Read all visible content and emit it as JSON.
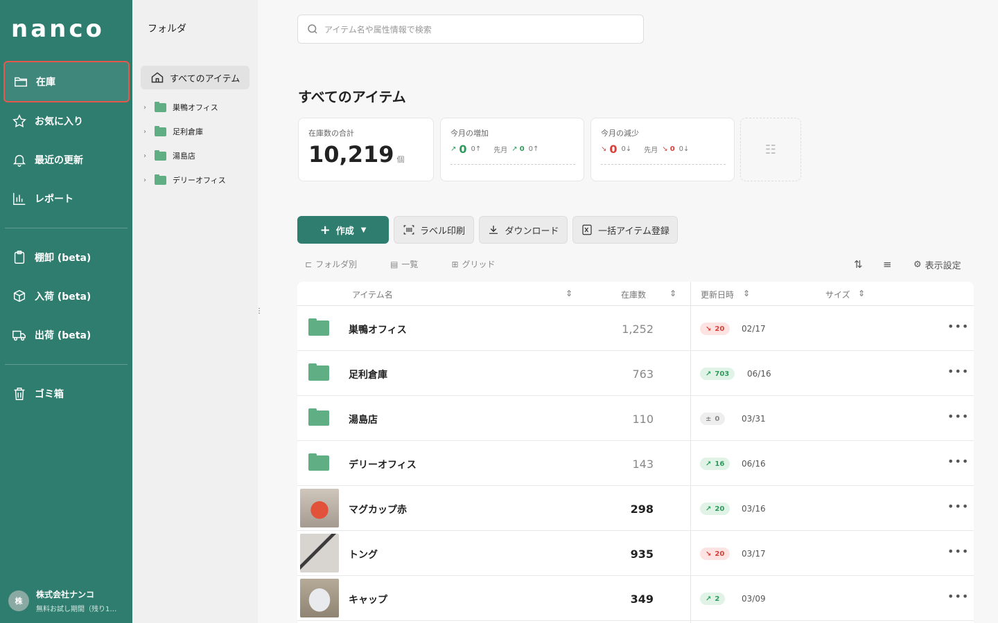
{
  "sidebar": {
    "logo": "nanco",
    "nav": [
      {
        "label": "在庫",
        "icon": "folder-open-icon"
      },
      {
        "label": "お気に入り",
        "icon": "star-icon"
      },
      {
        "label": "最近の更新",
        "icon": "bell-icon"
      },
      {
        "label": "レポート",
        "icon": "bar-chart-icon"
      },
      {
        "label": "棚卸 (beta)",
        "icon": "clipboard-icon"
      },
      {
        "label": "入荷 (beta)",
        "icon": "box-plus-icon"
      },
      {
        "label": "出荷 (beta)",
        "icon": "truck-icon"
      },
      {
        "label": "ゴミ箱",
        "icon": "trash-icon"
      }
    ],
    "account": {
      "avatar": "株",
      "name": "株式会社ナンコ",
      "sub": "無料お試し期間（残り1…"
    }
  },
  "folders": {
    "title": "フォルダ",
    "all_items": "すべてのアイテム",
    "tree": [
      "巣鴨オフィス",
      "足利倉庫",
      "湯島店",
      "デリーオフィス"
    ]
  },
  "search": {
    "placeholder": "アイテム名や属性情報で検索"
  },
  "page_title": "すべてのアイテム",
  "stats": {
    "total_label": "在庫数の合計",
    "total_value": "10,219",
    "total_unit": "個",
    "increase_label": "今月の増加",
    "increase_value": "0",
    "increase_small": "0",
    "increase_prev_label": "先月",
    "increase_prev_value": "0",
    "increase_prev_small": "0",
    "decrease_label": "今月の減少",
    "decrease_value": "0",
    "decrease_small": "0",
    "decrease_prev_label": "先月",
    "decrease_prev_value": "0",
    "decrease_prev_small": "0"
  },
  "toolbar": {
    "create": "作成",
    "label_print": "ラベル印刷",
    "download": "ダウンロード",
    "bulk_register": "一括アイテム登録",
    "view_folder": "フォルダ別",
    "view_list": "一覧",
    "view_grid": "グリッド",
    "display_settings": "表示設定"
  },
  "table": {
    "headers": {
      "name": "アイテム名",
      "qty": "在庫数",
      "updated": "更新日時",
      "size": "サイズ"
    },
    "rows": [
      {
        "name": "巣鴨オフィス",
        "qty": "1,252",
        "delta": "20",
        "date": "02/17",
        "type": "folder",
        "trend": "down"
      },
      {
        "name": "足利倉庫",
        "qty": "763",
        "delta": "703",
        "date": "06/16",
        "type": "folder",
        "trend": "up"
      },
      {
        "name": "湯島店",
        "qty": "110",
        "delta": "0",
        "date": "03/31",
        "type": "folder",
        "trend": "neutral"
      },
      {
        "name": "デリーオフィス",
        "qty": "143",
        "delta": "16",
        "date": "06/16",
        "type": "folder",
        "trend": "up"
      },
      {
        "name": "マグカップ赤",
        "qty": "298",
        "delta": "20",
        "date": "03/16",
        "type": "item",
        "trend": "up"
      },
      {
        "name": "トング",
        "qty": "935",
        "delta": "20",
        "date": "03/17",
        "type": "item",
        "trend": "down"
      },
      {
        "name": "キャップ",
        "qty": "349",
        "delta": "2",
        "date": "03/09",
        "type": "item",
        "trend": "up"
      }
    ]
  },
  "colors": {
    "brand": "#2e7d6f",
    "folder": "#5fae84",
    "up": "#2e9a5c",
    "down": "#d9403a",
    "active_outline": "#e8574c"
  }
}
